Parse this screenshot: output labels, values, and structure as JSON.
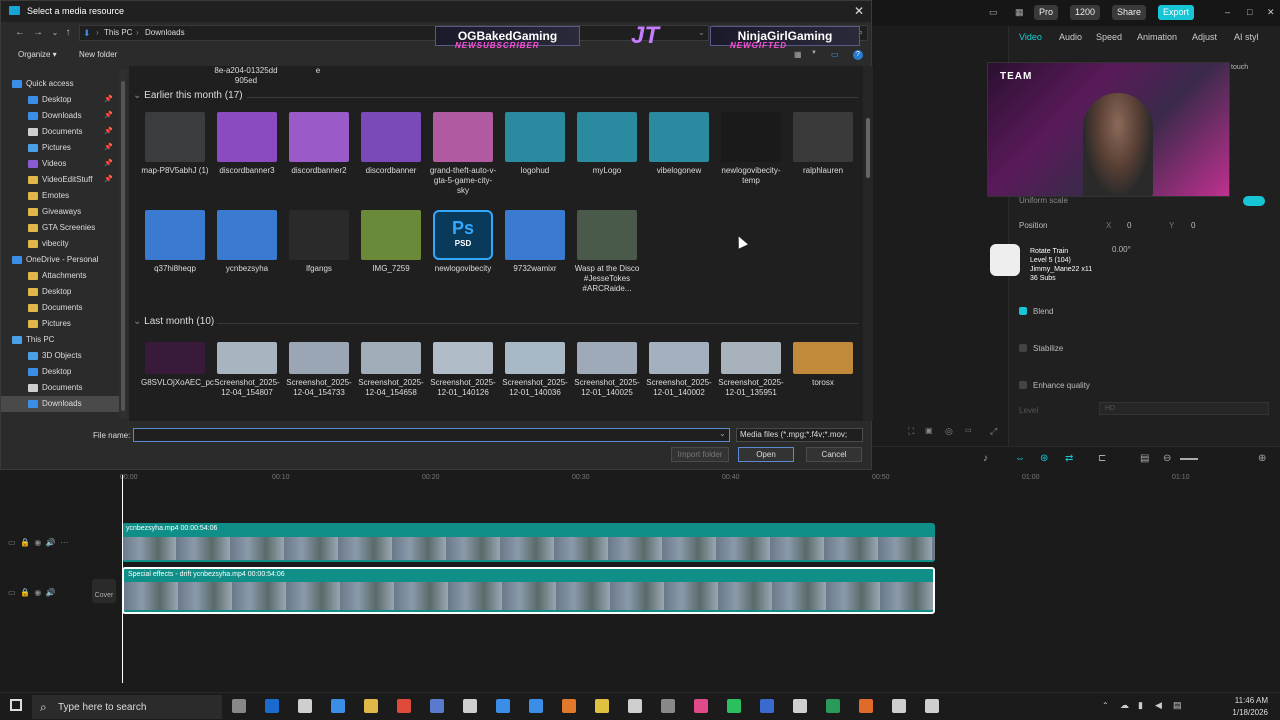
{
  "dialog": {
    "title": "Select a media resource",
    "close": "✕",
    "breadcrumb": [
      "This PC",
      "Downloads"
    ],
    "commands": {
      "organize": "Organize ▾",
      "new_folder": "New folder"
    },
    "nav": [
      {
        "label": "Quick access",
        "icon": "star",
        "color": "#3a8ee6",
        "indent": 0,
        "pin": false
      },
      {
        "label": "Desktop",
        "icon": "folder",
        "color": "#3a8ee6",
        "indent": 1,
        "pin": true
      },
      {
        "label": "Downloads",
        "icon": "download",
        "color": "#3a8ee6",
        "indent": 1,
        "pin": true
      },
      {
        "label": "Documents",
        "icon": "folder",
        "color": "#cfcfcf",
        "indent": 1,
        "pin": true
      },
      {
        "label": "Pictures",
        "icon": "folder",
        "color": "#4aa0e6",
        "indent": 1,
        "pin": true
      },
      {
        "label": "Videos",
        "icon": "folder",
        "color": "#8a5ad0",
        "indent": 1,
        "pin": true
      },
      {
        "label": "VideoEditStuff",
        "icon": "folder",
        "color": "#e0b84a",
        "indent": 1,
        "pin": true
      },
      {
        "label": "Emotes",
        "icon": "folder",
        "color": "#e0b84a",
        "indent": 1,
        "pin": false
      },
      {
        "label": "Giveaways",
        "icon": "folder",
        "color": "#e0b84a",
        "indent": 1,
        "pin": false
      },
      {
        "label": "GTA Screenies",
        "icon": "folder",
        "color": "#e0b84a",
        "indent": 1,
        "pin": false
      },
      {
        "label": "vibecity",
        "icon": "folder",
        "color": "#e0b84a",
        "indent": 1,
        "pin": false
      },
      {
        "label": "OneDrive - Personal",
        "icon": "cloud",
        "color": "#3a8ee6",
        "indent": 0,
        "pin": false
      },
      {
        "label": "Attachments",
        "icon": "folder",
        "color": "#e0b84a",
        "indent": 1,
        "pin": false
      },
      {
        "label": "Desktop",
        "icon": "folder",
        "color": "#e0b84a",
        "indent": 1,
        "pin": false
      },
      {
        "label": "Documents",
        "icon": "folder",
        "color": "#e0b84a",
        "indent": 1,
        "pin": false
      },
      {
        "label": "Pictures",
        "icon": "folder",
        "color": "#e0b84a",
        "indent": 1,
        "pin": false
      },
      {
        "label": "This PC",
        "icon": "pc",
        "color": "#4aa0e6",
        "indent": 0,
        "pin": false
      },
      {
        "label": "3D Objects",
        "icon": "folder",
        "color": "#4aa0e6",
        "indent": 1,
        "pin": false
      },
      {
        "label": "Desktop",
        "icon": "folder",
        "color": "#3a8ee6",
        "indent": 1,
        "pin": false
      },
      {
        "label": "Documents",
        "icon": "folder",
        "color": "#cfcfcf",
        "indent": 1,
        "pin": false
      },
      {
        "label": "Downloads",
        "icon": "download",
        "color": "#3a8ee6",
        "indent": 1,
        "pin": false,
        "selected": true
      }
    ],
    "partial_row": [
      "8e-a204-01325dd 905ed",
      "e"
    ],
    "groups": [
      {
        "heading": "Earlier this month (17)",
        "files": [
          {
            "name": "map-P8V5abhJ (1)",
            "thumb": "#3a3d40"
          },
          {
            "name": "discordbanner3",
            "thumb": "#8a4ac0"
          },
          {
            "name": "discordbanner2",
            "thumb": "#9a5ac8"
          },
          {
            "name": "discordbanner",
            "thumb": "#7a4ab8"
          },
          {
            "name": "grand-theft-auto-v-gta-5-game-city-sky",
            "thumb": "#b05aa0"
          },
          {
            "name": "logohud",
            "thumb": "#2a8aa0"
          },
          {
            "name": "myLogo",
            "thumb": "#2a8aa0"
          },
          {
            "name": "vibelogonew",
            "thumb": "#2a8aa0"
          },
          {
            "name": "newlogovibecity-temp",
            "thumb": "#1a1a1a"
          },
          {
            "name": "ralphlauren",
            "thumb": "#3a3a3a"
          },
          {
            "name": "q37hi8heqp",
            "thumb": "#3a7ad0"
          },
          {
            "name": "ycnbezsyha",
            "thumb": "#3a7ad0"
          },
          {
            "name": "lfgangs",
            "thumb": "#2a2a2a"
          },
          {
            "name": "IMG_7259",
            "thumb": "#6a8a3a"
          },
          {
            "name": "newlogovibecity",
            "thumb": "#0a3a5a",
            "psd": "PSD",
            "ps": "Ps"
          },
          {
            "name": "9732wamixr",
            "thumb": "#3a7ad0"
          },
          {
            "name": "Wasp at the Disco #JesseTokes #ARCRaide...",
            "thumb": "#4a5a4a"
          }
        ]
      },
      {
        "heading": "Last month (10)",
        "files": [
          {
            "name": "G8SVLOjXoAEC_pc",
            "thumb": "#3a1a3a"
          },
          {
            "name": "Screenshot_2025-12-04_154807",
            "thumb": "#a8b4c0"
          },
          {
            "name": "Screenshot_2025-12-04_154733",
            "thumb": "#9aa6b4"
          },
          {
            "name": "Screenshot_2025-12-04_154658",
            "thumb": "#a0acb8"
          },
          {
            "name": "Screenshot_2025-12-01_140126",
            "thumb": "#b0bcc8"
          },
          {
            "name": "Screenshot_2025-12-01_140036",
            "thumb": "#a8b8c4"
          },
          {
            "name": "Screenshot_2025-12-01_140025",
            "thumb": "#9eaab8"
          },
          {
            "name": "Screenshot_2025-12-01_140002",
            "thumb": "#a4b0be"
          },
          {
            "name": "Screenshot_2025-12-01_135951",
            "thumb": "#a8b2bc"
          },
          {
            "name": "torosx",
            "thumb": "#c08a3a"
          }
        ]
      }
    ],
    "file_name_label": "File name:",
    "file_name_value": "",
    "file_type": "Media files (*.mpg;*.f4v;*.mov;",
    "import_folder": "Import folder",
    "open": "Open",
    "cancel": "Cancel"
  },
  "overlay": {
    "left_name": "OGBakedGaming",
    "left_sub": "NEWSUBSCRIBER",
    "right_name": "NinjaGirlGaming",
    "right_sub": "NEWGIFTED",
    "logo": "JT"
  },
  "editor": {
    "topbar": {
      "pro": "Pro",
      "credits": "1200",
      "share": "Share",
      "export": "Export"
    },
    "tabs": [
      "Video",
      "Audio",
      "Speed",
      "Animation",
      "Adjust",
      "AI styl"
    ],
    "uniform_scale": "Uniform scale",
    "position_label": "Position",
    "pos_x_label": "X",
    "pos_x": "0",
    "pos_y_label": "Y",
    "pos_y": "0",
    "rotate_value": "0.00°",
    "blend": "Blend",
    "stabilize": "Stabilize",
    "enhance": "Enhance quality",
    "level_label": "Level",
    "level_value": "HD",
    "touch": "touch",
    "webcam_text": "TEAM",
    "train_text": [
      "Rotate Train",
      "Level 5 (104)",
      "Jimmy_Mane22 x11",
      "36 Subs"
    ]
  },
  "timeline": {
    "ticks": [
      "00:00",
      "00:10",
      "00:20",
      "00:30",
      "00:40",
      "00:50",
      "01:00",
      "01:10"
    ],
    "clip1_label": "ycnbezsyha.mp4   00:00:54:06",
    "clip2_label": "Special effects - drift    ycnbezsyha.mp4   00:00:54:06",
    "cover": "Cover"
  },
  "taskbar": {
    "search_placeholder": "Type here to search",
    "time": "11:46 AM",
    "date": "1/18/2026",
    "apps": [
      "#888888",
      "#1a6ad0",
      "#cfcfcf",
      "#3a8ee6",
      "#e0b84a",
      "#e04a3a",
      "#5a7ad0",
      "#cfcfcf",
      "#3a8ee6",
      "#3a8ee6",
      "#e07a2a",
      "#e0c040",
      "#cfcfcf",
      "#888888",
      "#e04a8a",
      "#2ac060",
      "#3a6ad0",
      "#cfcfcf",
      "#2a9a5a",
      "#e06a2a",
      "#cfcfcf",
      "#cfcfcf"
    ]
  }
}
